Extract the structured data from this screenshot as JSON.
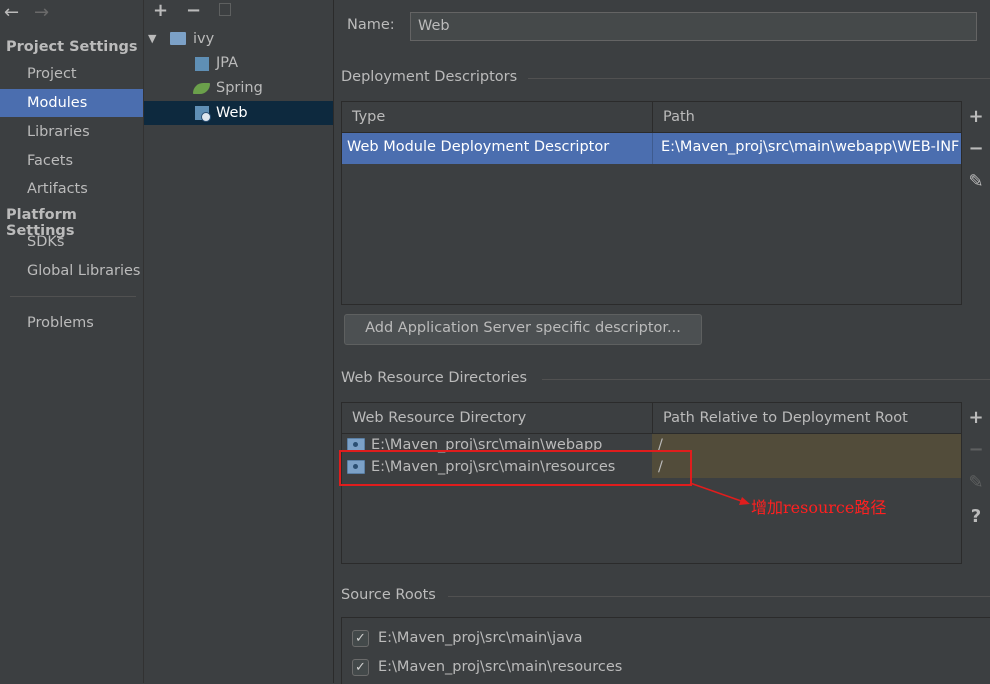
{
  "nav": {
    "back_arrow": "←",
    "forward_arrow": "→",
    "project_settings_label": "Project Settings",
    "platform_settings_label": "Platform Settings",
    "items": [
      {
        "label": "Project"
      },
      {
        "label": "Modules"
      },
      {
        "label": "Libraries"
      },
      {
        "label": "Facets"
      },
      {
        "label": "Artifacts"
      },
      {
        "label": "SDKs"
      },
      {
        "label": "Global Libraries"
      },
      {
        "label": "Problems"
      }
    ],
    "selected": "Modules"
  },
  "tree": {
    "add_glyph": "+",
    "remove_glyph": "−",
    "root": {
      "label": "ivy",
      "expander": "▼"
    },
    "children": [
      {
        "label": "JPA",
        "icon": "jpa-icon"
      },
      {
        "label": "Spring",
        "icon": "spring-leaf-icon"
      },
      {
        "label": "Web",
        "icon": "web-icon"
      }
    ],
    "selected": "Web"
  },
  "main": {
    "name_label": "Name:",
    "name_value": "Web",
    "deployment": {
      "title": "Deployment Descriptors",
      "columns": [
        "Type",
        "Path"
      ],
      "rows": [
        {
          "type": "Web Module Deployment Descriptor",
          "path": "E:\\Maven_proj\\src\\main\\webapp\\WEB-INF"
        }
      ],
      "add_server_button": "Add Application Server specific descriptor..."
    },
    "web_resources": {
      "title": "Web Resource Directories",
      "columns": [
        "Web Resource Directory",
        "Path Relative to Deployment Root"
      ],
      "rows": [
        {
          "dir": "E:\\Maven_proj\\src\\main\\webapp",
          "path": "/"
        },
        {
          "dir": "E:\\Maven_proj\\src\\main\\resources",
          "path": "/"
        }
      ]
    },
    "source_roots": {
      "title": "Source Roots",
      "items": [
        {
          "label": "E:\\Maven_proj\\src\\main\\java",
          "checked": true
        },
        {
          "label": "E:\\Maven_proj\\src\\main\\resources",
          "checked": true
        }
      ]
    },
    "tools": {
      "add": "+",
      "remove": "−",
      "edit": "✎",
      "help": "?"
    }
  },
  "annotation": {
    "text": "增加resource路径",
    "color": "#ff2020"
  },
  "colors": {
    "background": "#3c3f41",
    "selection": "#4b6eaf",
    "tree_selection": "#0d293e",
    "highlight_row": "#524c3a"
  }
}
